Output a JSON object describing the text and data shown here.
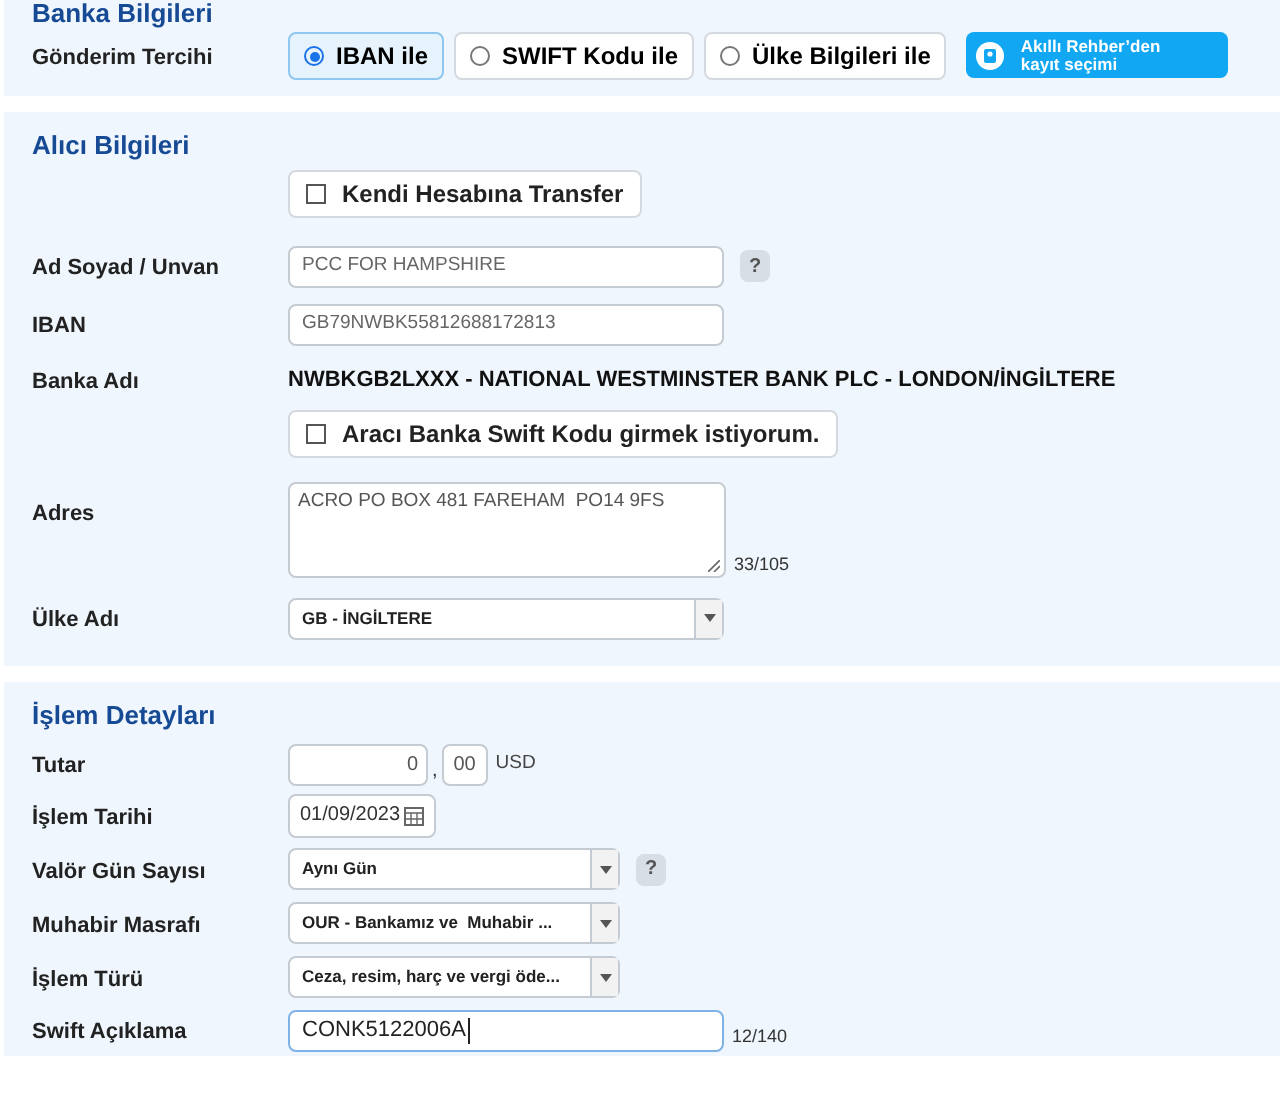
{
  "sections": [
    {
      "title": "Banka Bilgileri",
      "rows": [
        {
          "kind": "radios",
          "label": "Gönderim Tercihi",
          "options": [
            {
              "label": "IBAN ile",
              "selected": true
            },
            {
              "label": "SWIFT Kodu ile",
              "selected": false
            },
            {
              "label": "Ülke Bilgileri ile",
              "selected": false
            }
          ],
          "action": "Akıllı Rehber’den kayıt seçimi"
        }
      ]
    },
    {
      "title": "Alıcı Bilgileri",
      "rows": [
        {
          "kind": "checkbox",
          "label_text": "Kendi Hesabına Transfer",
          "checked": false
        },
        {
          "kind": "text",
          "label": "Ad Soyad / Unvan",
          "value": "PCC FOR HAMPSHIRE",
          "help": "?"
        },
        {
          "kind": "text",
          "label": "IBAN",
          "value": "GB79NWBK55812688172813"
        },
        {
          "kind": "static",
          "label": "Banka Adı",
          "value": "NWBKGB2LXXX - NATIONAL WESTMINSTER BANK PLC - LONDON/İNGİLTERE"
        },
        {
          "kind": "checkbox",
          "label_text": "Aracı Banka Swift Kodu girmek istiyorum.",
          "checked": false
        },
        {
          "kind": "textarea",
          "label": "Adres",
          "value": "ACRO PO BOX 481 FAREHAM  PO14 9FS",
          "counter": "33/105"
        },
        {
          "kind": "longselect",
          "label": "Ülke Adı",
          "value": "GB - İNGİLTERE"
        }
      ]
    },
    {
      "title": "İşlem Detayları",
      "rows": [
        {
          "kind": "amount",
          "label": "Tutar",
          "whole": "0",
          "separator": ",",
          "fraction": "00",
          "currency": "USD"
        },
        {
          "kind": "date",
          "label": "İşlem Tarihi",
          "value": "01/09/2023"
        },
        {
          "kind": "select",
          "label": "Valör Gün Sayısı",
          "value": "Aynı Gün",
          "help": "?"
        },
        {
          "kind": "select",
          "label": "Muhabir Masrafı",
          "value": "OUR - Bankamız ve  Muhabir ..."
        },
        {
          "kind": "select",
          "label": "İşlem Türü",
          "value": "Ceza, resim, harç ve vergi öde..."
        },
        {
          "kind": "text",
          "label": "Swift Açıklama",
          "value": "CONK5122006A",
          "counter": "12/140",
          "focused": true
        }
      ]
    }
  ]
}
